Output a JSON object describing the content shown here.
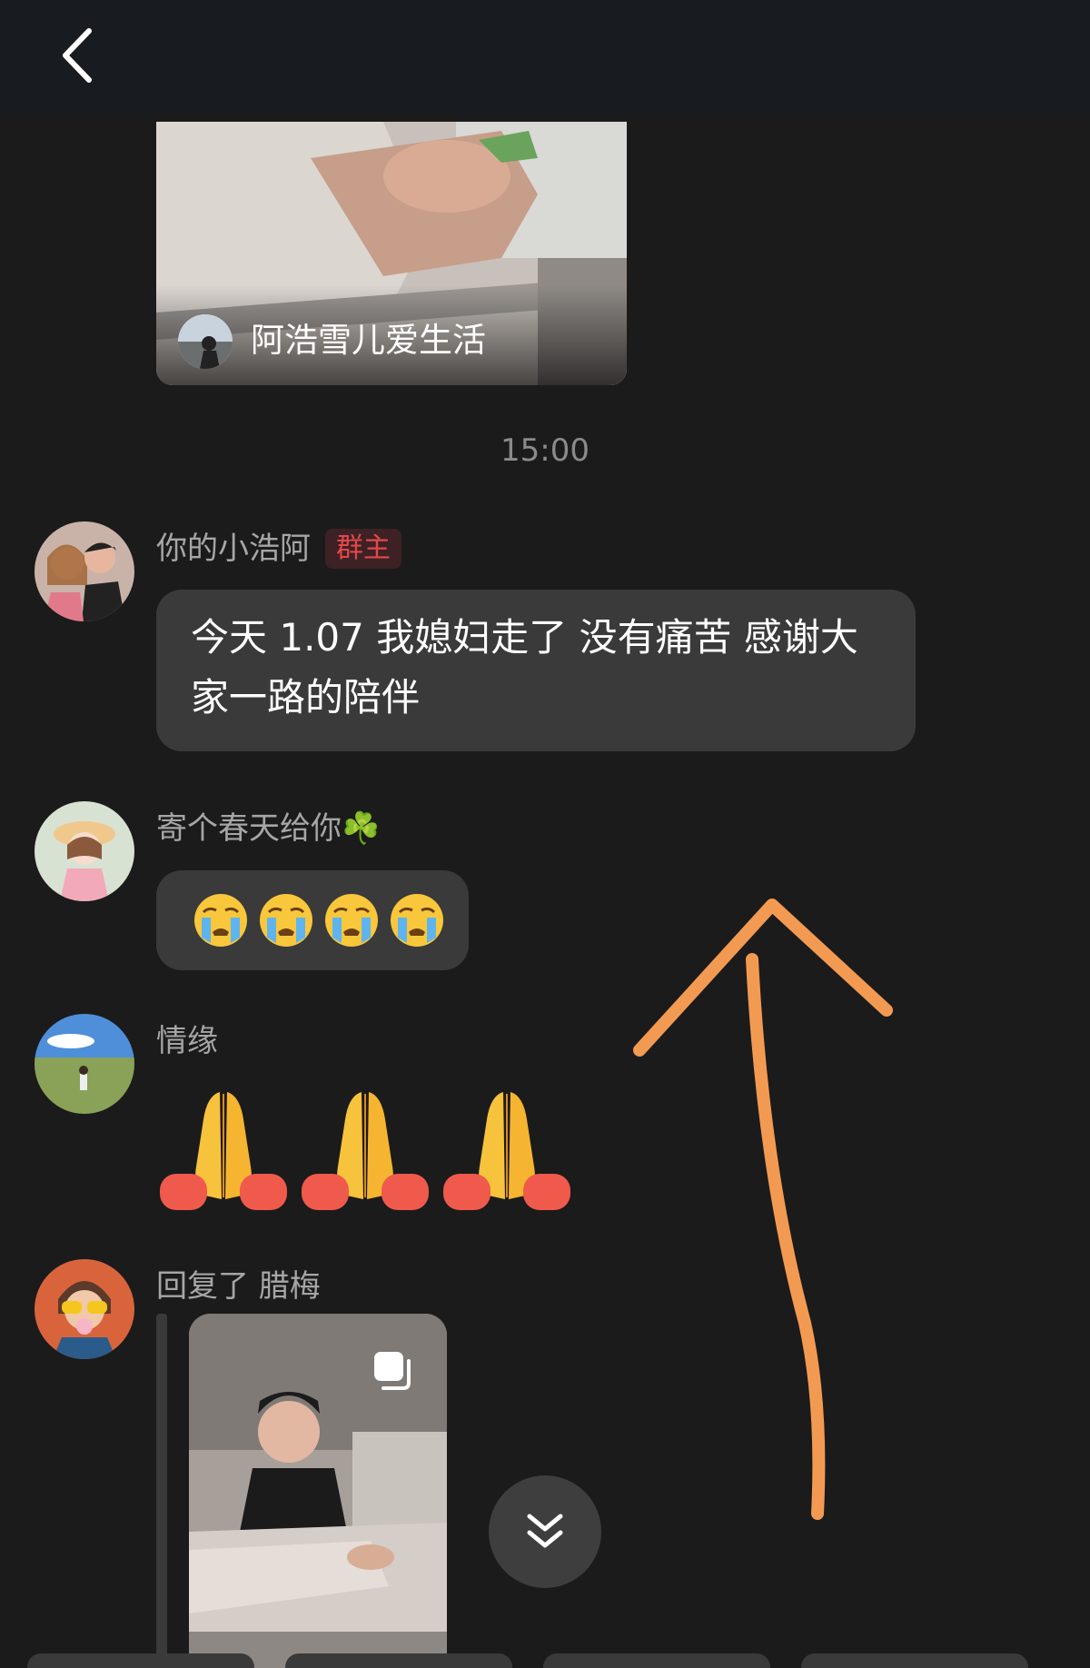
{
  "header": {
    "back_icon": "chevron-left-icon"
  },
  "shared_video": {
    "owner_name": "阿浩雪儿爱生活",
    "owner_avatar_icon": "user-avatar-icon"
  },
  "timestamp": "15:00",
  "messages": [
    {
      "sender": "你的小浩阿",
      "badge": "群主",
      "text": "今天 1.07 我媳妇走了 没有痛苦 感谢大家一路的陪伴"
    },
    {
      "sender": "寄个春天给你☘️",
      "emoji": [
        "😭",
        "😭",
        "😭",
        "😭"
      ]
    },
    {
      "sender": "情缘",
      "emoji": [
        "🙏",
        "🙏",
        "🙏"
      ]
    },
    {
      "sender": "回复了 腊梅",
      "attachment_icon": "multi-image-icon"
    }
  ],
  "controls": {
    "scroll_icon": "double-chevron-down-icon"
  },
  "colors": {
    "background": "#1b1b1b",
    "topbar": "#181b1f",
    "bubble": "#3a3a3a",
    "sender_text": "#a6a6a6",
    "badge_text": "#e4474b",
    "annotation": "#f39a52"
  }
}
